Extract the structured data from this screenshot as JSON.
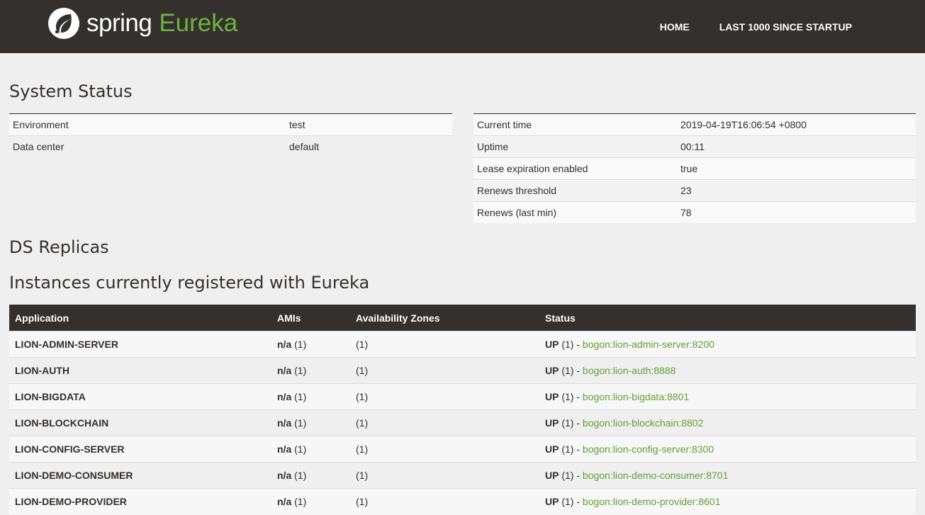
{
  "nav": {
    "brand_spring": "spring",
    "brand_eureka": "Eureka",
    "links": [
      "HOME",
      "LAST 1000 SINCE STARTUP"
    ]
  },
  "system_status": {
    "title": "System Status",
    "left": [
      {
        "key": "Environment",
        "value": "test"
      },
      {
        "key": "Data center",
        "value": "default"
      }
    ],
    "right": [
      {
        "key": "Current time",
        "value": "2019-04-19T16:06:54 +0800"
      },
      {
        "key": "Uptime",
        "value": "00:11"
      },
      {
        "key": "Lease expiration enabled",
        "value": "true"
      },
      {
        "key": "Renews threshold",
        "value": "23"
      },
      {
        "key": "Renews (last min)",
        "value": "78"
      }
    ]
  },
  "ds_replicas": {
    "title": "DS Replicas"
  },
  "instances": {
    "title": "Instances currently registered with Eureka",
    "headers": [
      "Application",
      "AMIs",
      "Availability Zones",
      "Status"
    ],
    "rows": [
      {
        "app": "LION-ADMIN-SERVER",
        "ami": "n/a",
        "ami_count": "(1)",
        "zones": "(1)",
        "status": "UP",
        "status_count": "(1) -",
        "link": "bogon:lion-admin-server:8200"
      },
      {
        "app": "LION-AUTH",
        "ami": "n/a",
        "ami_count": "(1)",
        "zones": "(1)",
        "status": "UP",
        "status_count": "(1) -",
        "link": "bogon:lion-auth:8888"
      },
      {
        "app": "LION-BIGDATA",
        "ami": "n/a",
        "ami_count": "(1)",
        "zones": "(1)",
        "status": "UP",
        "status_count": "(1) -",
        "link": "bogon:lion-bigdata:8801"
      },
      {
        "app": "LION-BLOCKCHAIN",
        "ami": "n/a",
        "ami_count": "(1)",
        "zones": "(1)",
        "status": "UP",
        "status_count": "(1) -",
        "link": "bogon:lion-blockchain:8802"
      },
      {
        "app": "LION-CONFIG-SERVER",
        "ami": "n/a",
        "ami_count": "(1)",
        "zones": "(1)",
        "status": "UP",
        "status_count": "(1) -",
        "link": "bogon:lion-config-server:8300"
      },
      {
        "app": "LION-DEMO-CONSUMER",
        "ami": "n/a",
        "ami_count": "(1)",
        "zones": "(1)",
        "status": "UP",
        "status_count": "(1) -",
        "link": "bogon:lion-demo-consumer:8701"
      },
      {
        "app": "LION-DEMO-PROVIDER",
        "ami": "n/a",
        "ami_count": "(1)",
        "zones": "(1)",
        "status": "UP",
        "status_count": "(1) -",
        "link": "bogon:lion-demo-provider:8601"
      }
    ]
  },
  "colors": {
    "navbar": "#34302d",
    "accent_green": "#6db33f",
    "link_green": "#5fa134",
    "background": "#efefef"
  },
  "icons": {
    "brand_logo": "spring-leaf-icon"
  }
}
